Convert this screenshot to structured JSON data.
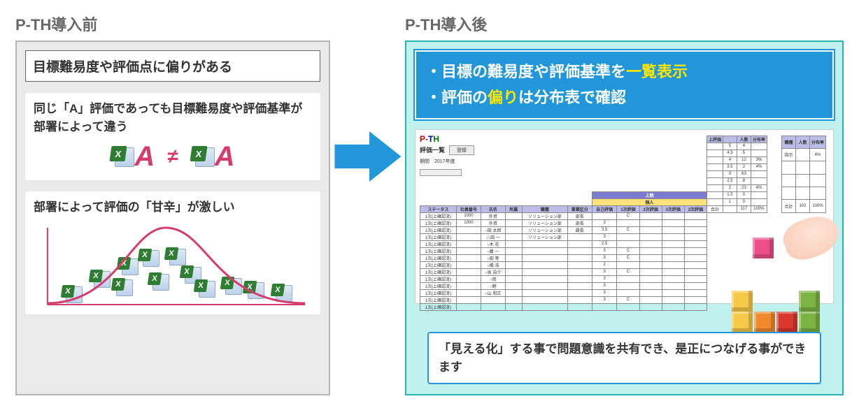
{
  "left": {
    "title": "P-TH導入前",
    "heading": "目標難易度や評価点に偏りがある",
    "box1_text": "同じ「A」評価であっても目標難易度や評価基準が部署によって違う",
    "A": "A",
    "neq": "≠",
    "box2_text": "部署によって評価の「甘辛」が激しい",
    "excel_glyph": "X"
  },
  "right": {
    "title": "P-TH導入後",
    "hero_line1_pre": "・目標の難易度や評価基準を",
    "hero_line1_hl": "一覧表示",
    "hero_line2_pre": "・評価の",
    "hero_line2_hl": "偏り",
    "hero_line2_post": "は分布表で確認",
    "bottom_note": "「見える化」する事で問題意識を共有でき、是正につなげる事ができます"
  },
  "screenshot": {
    "logo": "P-TH",
    "title": "評価一覧",
    "btn": "登録",
    "period_label": "期間　2017年度",
    "sum1": {
      "cols": [
        "上評価",
        "",
        "人数",
        "分布率"
      ],
      "rows": [
        [
          "",
          "5",
          "4",
          ""
        ],
        [
          "",
          "4.5",
          "5",
          ""
        ],
        [
          "",
          "4",
          "12",
          "3%"
        ],
        [
          "",
          "3.5",
          "2",
          "4%"
        ],
        [
          "",
          "3",
          "63",
          ""
        ],
        [
          "",
          "2.5",
          "8",
          ""
        ],
        [
          "",
          "2",
          "23",
          "4%"
        ],
        [
          "",
          "1.5",
          "0",
          ""
        ],
        [
          "",
          "1",
          "0",
          ""
        ],
        [
          "合計",
          "",
          "117",
          "100%"
        ]
      ]
    },
    "sum2": {
      "cols": [
        "職種",
        "人数",
        "分布率"
      ],
      "rows": [
        [
          "指示",
          "",
          "4%"
        ],
        [
          "",
          "",
          ""
        ],
        [
          "",
          "",
          ""
        ],
        [
          "",
          "",
          ""
        ],
        [
          "合計",
          "102",
          "100%"
        ]
      ]
    },
    "main": {
      "group1": "上期",
      "group2": "個人",
      "cols": [
        "ステータス",
        "社員番号",
        "氏名",
        "所属",
        "職種",
        "事業区分",
        "自己評価",
        "1次評価",
        "2次評価",
        "3次評価",
        "2次評価"
      ],
      "rows": [
        [
          "1次(上確認済)",
          "1000",
          "外資",
          "",
          "ソリューション部",
          "部長",
          "",
          "C",
          "",
          "",
          ""
        ],
        [
          "1次(上確認済)",
          "1000",
          "外資",
          "",
          "ソリューション部",
          "部長",
          "3",
          "",
          "",
          "",
          ""
        ],
        [
          "1次(上確認済)",
          "",
          "○田 太郎",
          "",
          "ソリューション部",
          "課長",
          "3.5",
          "C",
          "",
          "",
          ""
        ],
        [
          "1次(上確認済)",
          "",
          "△田 一",
          "",
          "ソリューション部",
          "",
          "3",
          "",
          "",
          "",
          ""
        ],
        [
          "1次(上確認済)",
          "",
          "○木 花",
          "",
          "",
          "",
          "2.5",
          "",
          "",
          "",
          ""
        ],
        [
          "1次(上確認済)",
          "",
          "○藤 一",
          "",
          "",
          "",
          "3",
          "C",
          "",
          "",
          ""
        ],
        [
          "1次(上確認済)",
          "",
          "○田 等",
          "",
          "",
          "",
          "3",
          "C",
          "",
          "",
          ""
        ],
        [
          "1次(上確認済)",
          "",
          "○橋 浩",
          "",
          "",
          "",
          "2",
          "",
          "",
          "",
          ""
        ],
        [
          "1次(上確認済)",
          "",
          "○坂 自介",
          "",
          "",
          "",
          "3",
          "C",
          "",
          "",
          ""
        ],
        [
          "1次(上確認済)",
          "",
          "○岡",
          "",
          "",
          "",
          "3",
          "",
          "",
          "",
          ""
        ],
        [
          "1次(上確認済)",
          "",
          "○野",
          "",
          "",
          "",
          "3",
          "",
          "",
          "",
          ""
        ],
        [
          "1次(上確認済)",
          "",
          "○山 和正",
          "",
          "",
          "",
          "3",
          "",
          "",
          "",
          ""
        ],
        [
          "1次(上確認済)",
          "",
          "",
          "",
          "",
          "",
          "3",
          "C",
          "",
          "",
          ""
        ],
        [
          "1次(上確認済)",
          "",
          "",
          "",
          "",
          "",
          "",
          "",
          "",
          "",
          ""
        ]
      ]
    }
  },
  "blocks_colors": {
    "pink": "#ec4f86",
    "yellow": "#f7c948",
    "orange": "#f08a2c",
    "red": "#d8392c",
    "green": "#7cb342"
  }
}
